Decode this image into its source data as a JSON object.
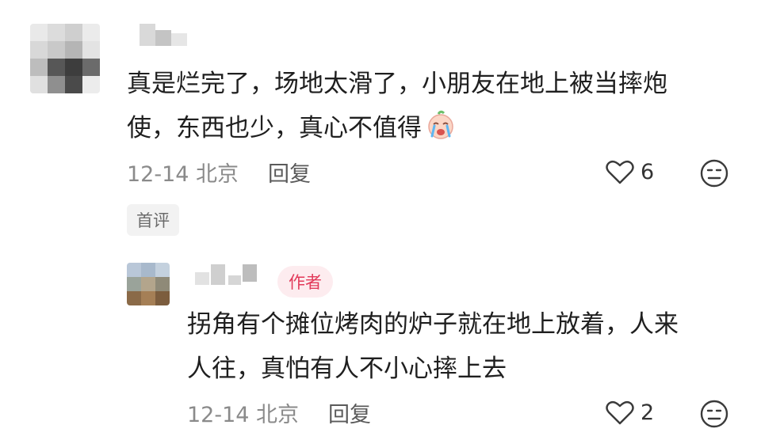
{
  "comments": [
    {
      "text_line1": "真是烂完了，场地太滑了，小朋友在地上被当摔炮",
      "text_line2": "使，东西也少，真心不值得",
      "emoji": "crying-face-emoji",
      "meta": "12-14 北京",
      "reply_label": "回复",
      "like_count": "6",
      "badge": "首评"
    },
    {
      "author_badge": "作者",
      "text_line1": "拐角有个摊位烤肉的炉子就在地上放着，人来",
      "text_line2": "人往，真怕有人不小心摔上去",
      "meta": "12-14 北京",
      "reply_label": "回复",
      "like_count": "2"
    }
  ],
  "icons": {
    "like": "heart-outline-icon",
    "react": "neutral-face-icon"
  },
  "colors": {
    "text": "#1f1f1f",
    "meta": "#8a8a8a",
    "author_badge_bg": "#fdecef",
    "author_badge_text": "#e23a5a",
    "first_badge_bg": "#f2f2f2"
  }
}
